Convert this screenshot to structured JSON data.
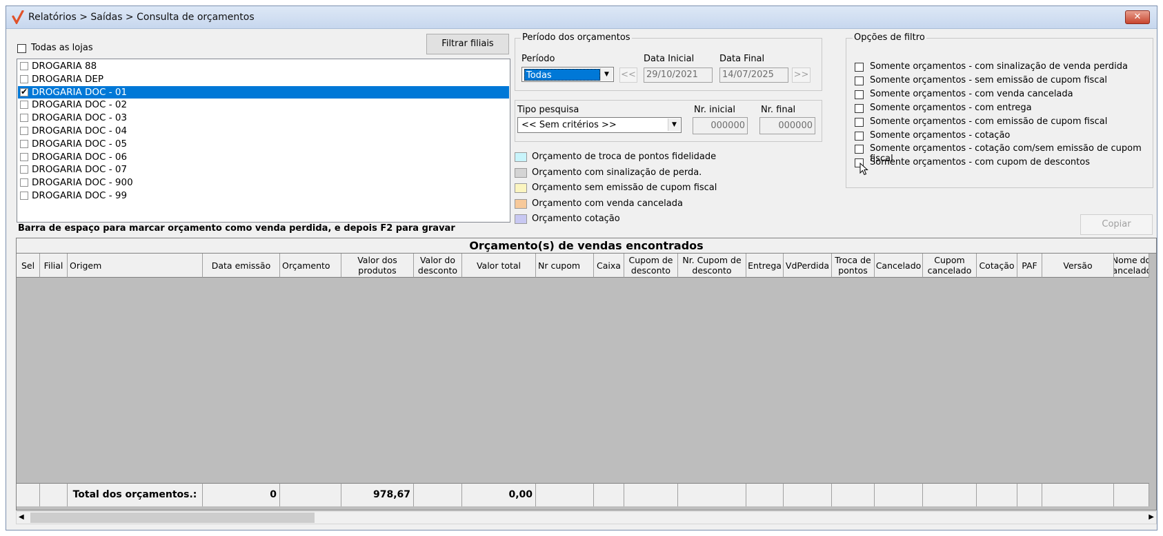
{
  "window": {
    "title": "Relatórios > Saídas > Consulta de orçamentos",
    "close_label": "✕"
  },
  "stores": {
    "all_label": "Todas as lojas",
    "filter_button": "Filtrar filiais",
    "items": [
      {
        "label": "DROGARIA 88",
        "checked": false,
        "selected": false
      },
      {
        "label": "DROGARIA DEP",
        "checked": false,
        "selected": false
      },
      {
        "label": "DROGARIA DOC - 01",
        "checked": true,
        "selected": true
      },
      {
        "label": "DROGARIA DOC - 02",
        "checked": false,
        "selected": false
      },
      {
        "label": "DROGARIA DOC - 03",
        "checked": false,
        "selected": false
      },
      {
        "label": "DROGARIA DOC - 04",
        "checked": false,
        "selected": false
      },
      {
        "label": "DROGARIA DOC - 05",
        "checked": false,
        "selected": false
      },
      {
        "label": "DROGARIA DOC - 06",
        "checked": false,
        "selected": false
      },
      {
        "label": "DROGARIA DOC - 07",
        "checked": false,
        "selected": false
      },
      {
        "label": "DROGARIA DOC - 900",
        "checked": false,
        "selected": false
      },
      {
        "label": "DROGARIA DOC - 99",
        "checked": false,
        "selected": false
      }
    ]
  },
  "period": {
    "group_label": "Período dos orçamentos",
    "period_label": "Período",
    "period_value": "Todas",
    "start_label": "Data Inicial",
    "start_value": "29/10/2021",
    "end_label": "Data Final",
    "end_value": "14/07/2025",
    "prev_label": "<<",
    "next_label": ">>"
  },
  "search": {
    "type_label": "Tipo pesquisa",
    "type_value": "<< Sem critérios >>",
    "nr_start_label": "Nr. inicial",
    "nr_start_value": "000000",
    "nr_end_label": "Nr. final",
    "nr_end_value": "000000"
  },
  "legend_items": [
    {
      "label": "Orçamento de troca de pontos fidelidade",
      "color": "#c8f4fb"
    },
    {
      "label": "Orçamento com sinalização de perda.",
      "color": "#d4d4d4"
    },
    {
      "label": "Orçamento sem emissão de cupom fiscal",
      "color": "#fbf5c0"
    },
    {
      "label": "Orçamento com venda cancelada",
      "color": "#f7c99a"
    },
    {
      "label": "Orçamento cotação",
      "color": "#c8c8f2"
    }
  ],
  "filter_options": {
    "group_label": "Opções de filtro",
    "items": [
      "Somente orçamentos - com sinalização de venda perdida",
      "Somente orçamentos - sem emissão de cupom fiscal",
      "Somente orçamentos - com venda cancelada",
      "Somente orçamentos - com entrega",
      "Somente orçamentos - com emissão de cupom fiscal",
      "Somente orçamentos - cotação",
      "Somente orçamentos - cotação com/sem emissão de cupom fiscal",
      "Somente orçamentos - com cupom de descontos"
    ]
  },
  "copy_button": "Copiar",
  "hint": "Barra de espaço para marcar orçamento como venda perdida, e depois F2 para gravar",
  "grid": {
    "title": "Orçamento(s) de vendas encontrados",
    "columns": [
      "Sel",
      "Filial",
      "Origem",
      "Data emissão",
      "Orçamento",
      "Valor dos\nprodutos",
      "Valor do\ndesconto",
      "Valor total",
      "Nr cupom",
      "Caixa",
      "Cupom de\ndesconto",
      "Nr. Cupom de\ndesconto",
      "Entrega",
      "VdPerdida",
      "Troca de\npontos",
      "Cancelado",
      "Cupom\ncancelado",
      "Cotação",
      "PAF",
      "Versão",
      "Nome do\ncancelador"
    ],
    "totals": {
      "label": "Total dos orçamentos.:",
      "count": "0",
      "products": "978,67",
      "total": "0,00"
    }
  }
}
